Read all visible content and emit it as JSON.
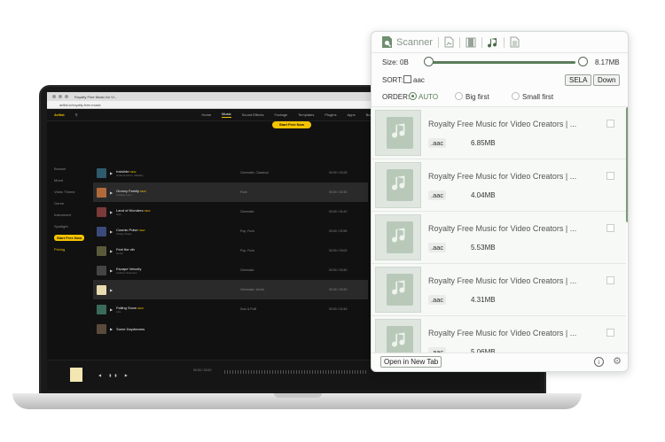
{
  "laptop": {
    "browser_tab": "Royalty Free Music for Vi...",
    "url": "artlist.io/royalty-free-music",
    "nav": {
      "brand": "Artlist",
      "items": [
        "Home",
        "Music",
        "Sound Effects",
        "Footage",
        "Templates",
        "Plugins",
        "Apps",
        "Business"
      ],
      "active": "Music"
    },
    "cta": "Start Free Now",
    "side_menu": [
      "Browse",
      "Mood",
      "Video Theme",
      "Genre",
      "Instrument",
      "Spotlight"
    ],
    "side_cta": "Start Free Now",
    "side_pricing": "Pricing",
    "tracks": [
      {
        "title": "Invisible",
        "new": "NEW",
        "sub": "Arianna Chen, Ohbaby",
        "genre": "Cinematic, Classical",
        "time": "00:00 / 03:25",
        "color": "#2d5b6b"
      },
      {
        "title": "Groovy Family",
        "new": "NEW",
        "sub": "Lindsey Lynn",
        "genre": "Funk",
        "time": "00:00 / 02:30",
        "color": "#b36a3a"
      },
      {
        "title": "Land of Wonders",
        "new": "NEW",
        "sub": "Ivan",
        "genre": "Cinematic",
        "time": "00:00 / 04:10",
        "color": "#7a3a3a"
      },
      {
        "title": "Cosmic Pulse",
        "new": "NEW",
        "sub": "Chirpy Frase",
        "genre": "Pop, Funk",
        "time": "00:00 / 02:55",
        "color": "#3a4a7a"
      },
      {
        "title": "Feel the vib",
        "new": "",
        "sub": "Aerini",
        "genre": "Pop, Funk",
        "time": "00:00 / 03:00",
        "color": "#5a5a3a"
      },
      {
        "title": "Escape Velocity",
        "new": "",
        "sub": "Anthem Sciences",
        "genre": "Cinematic",
        "time": "00:00 / 03:40",
        "color": "#444"
      },
      {
        "title": "",
        "new": "",
        "sub": "",
        "genre": "Cinematic, World",
        "time": "00:00 / 03:20",
        "color": "#e8dcb0"
      },
      {
        "title": "Falling Snow",
        "new": "NEW",
        "sub": "Lilio",
        "genre": "Soul & RnB",
        "time": "00:00 / 02:45",
        "color": "#3a6a5a"
      },
      {
        "title": "Some Daydreams",
        "new": "",
        "sub": "",
        "genre": "",
        "time": "",
        "color": "#5a4a3a"
      }
    ],
    "player_time": "00:00 / 03:20"
  },
  "scanner": {
    "tabs": {
      "scanner_label": "Scanner"
    },
    "size": {
      "label": "Size: 0B",
      "max": "8.17MB"
    },
    "sort": {
      "label": "SORT:",
      "ext": "aac",
      "sela_label": "SELA",
      "down_label": "Down"
    },
    "order": {
      "label": "ORDER:",
      "auto": "AUTO",
      "big_first": "Big first",
      "small_first": "Small first"
    },
    "items": [
      {
        "name": "Royalty Free Music for Video Creators | ...",
        "ext": ".aac",
        "size": "6.85MB"
      },
      {
        "name": "Royalty Free Music for Video Creators | ...",
        "ext": ".aac",
        "size": "4.04MB"
      },
      {
        "name": "Royalty Free Music for Video Creators | ...",
        "ext": ".aac",
        "size": "5.53MB"
      },
      {
        "name": "Royalty Free Music for Video Creators | ...",
        "ext": ".aac",
        "size": "4.31MB"
      },
      {
        "name": "Royalty Free Music for Video Creators | ...",
        "ext": ".aac",
        "size": "5.06MB"
      }
    ],
    "footer": {
      "open_label": "Open in New Tab",
      "info": "i",
      "gear": "⚙"
    },
    "colors": {
      "accent": "#5a7e5a",
      "file_icon_bg": "#b9c9b9"
    }
  }
}
